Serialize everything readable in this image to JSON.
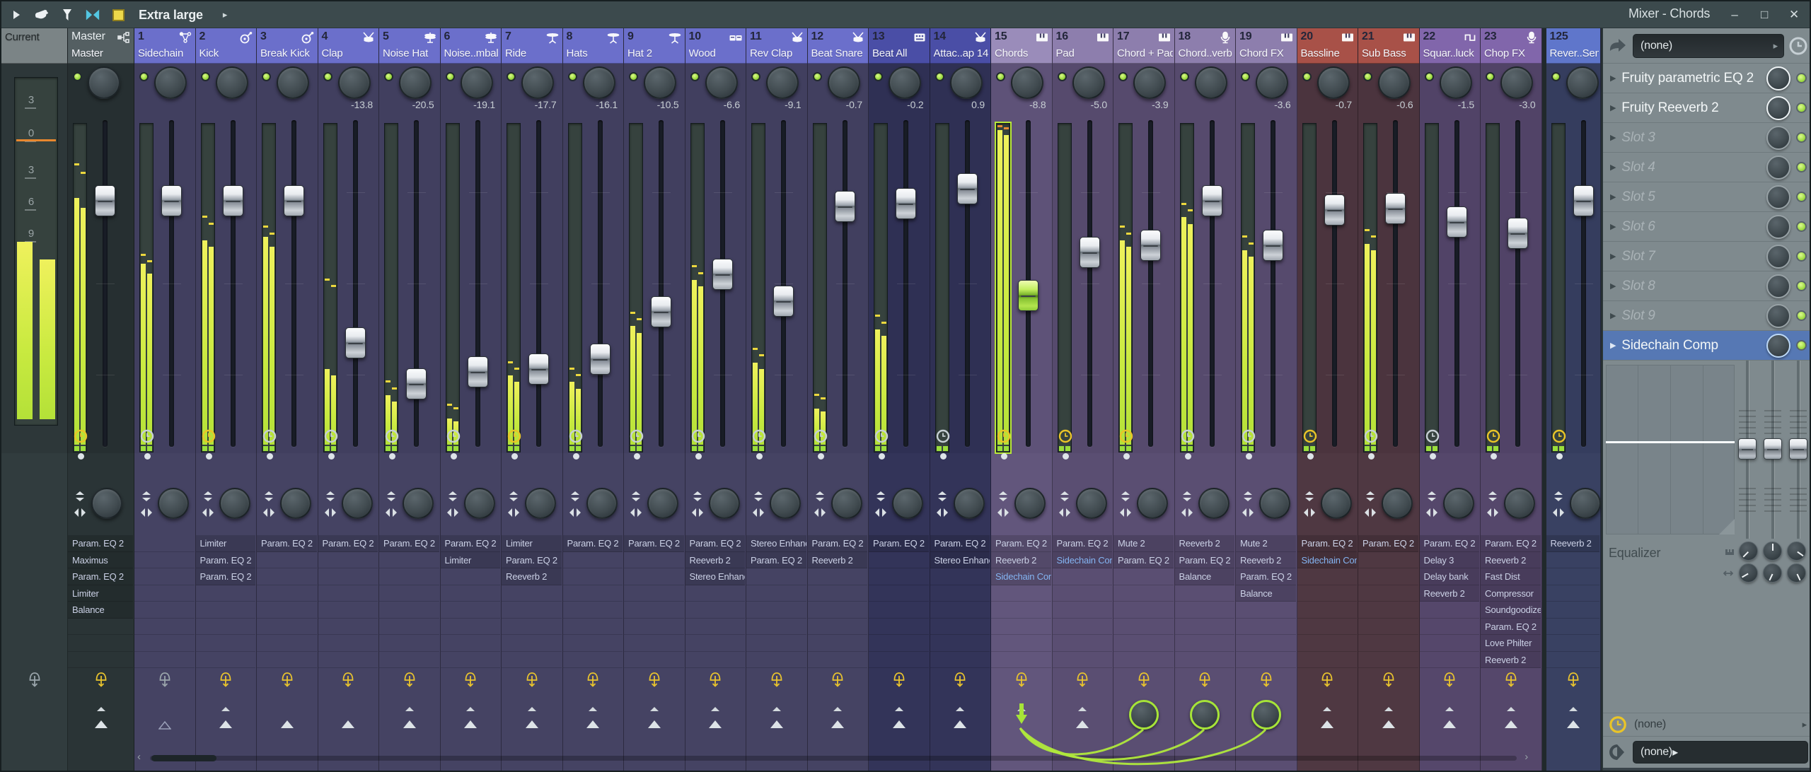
{
  "window": {
    "title": "Mixer - Chords",
    "buttons": {
      "minimize": "–",
      "maximize": "□",
      "close": "✕"
    }
  },
  "toolbar": {
    "view_mode": "Extra large",
    "icons": [
      "menu-arrow",
      "hand",
      "funnel",
      "link-bowtie",
      "color-swatch"
    ],
    "submenu_arrow": "▸"
  },
  "colors": {
    "accent_green": "#aee63c",
    "meter_yellow": "#e9ee54",
    "peak_orange": "#e88a34",
    "lamp_yellow": "#e9c42e",
    "lamp_gray": "#9aa5ab",
    "clock_yellow": "#e9c428",
    "clock_gray": "#c6cfd4",
    "groups": {
      "current": {
        "header": "#7b8486",
        "body": "#2d3739",
        "body2": "#313c3e"
      },
      "master": {
        "header": "#545f62",
        "body": "#262f31",
        "body2": "#2a3436"
      },
      "blue": {
        "header": "#6b6fcb",
        "body": "#413f5f",
        "body2": "#454363"
      },
      "navy": {
        "header": "#4a4ea6",
        "body": "#2f3054",
        "body2": "#333459"
      },
      "violet": {
        "header": "#8d7ead",
        "body": "#564a6d",
        "body2": "#5a4e72"
      },
      "violetsel": {
        "header": "#9a8cba",
        "body": "#5e5278",
        "body2": "#62567c"
      },
      "red": {
        "header": "#a85148",
        "body": "#4b343e",
        "body2": "#4f3842"
      },
      "purple": {
        "header": "#8166ab",
        "body": "#514367",
        "body2": "#55476b"
      },
      "send": {
        "header": "#5f76cb",
        "body": "#353d5e",
        "body2": "#394162"
      }
    }
  },
  "current_strip": {
    "label": "Current",
    "scale_labels": [
      "3",
      "0",
      "3",
      "6",
      "9"
    ],
    "scale_fracs": [
      0.065,
      0.16,
      0.266,
      0.357,
      0.448
    ],
    "peak_frac": 0.177,
    "meter_l": 0.462,
    "meter_r": 0.513,
    "lamp": "gray"
  },
  "strips": [
    {
      "num": "",
      "name": "Master",
      "tab": "Master",
      "icon": "routing",
      "group": "master",
      "db": "",
      "fader": 0.22,
      "meter": {
        "l": 0.22,
        "r": 0.25,
        "pl": 0.12,
        "pr": 0.145
      },
      "clock": "yellow",
      "caret": true,
      "plugins": [
        {
          "n": "Param. EQ 2"
        },
        {
          "n": "Maximus"
        },
        {
          "n": "Param. EQ 2"
        },
        {
          "n": "Limiter"
        },
        {
          "n": "Balance"
        }
      ]
    },
    {
      "num": "1",
      "name": "Sidechain",
      "icon": "sidechain",
      "group": "blue",
      "db": "",
      "fader": 0.22,
      "meter": {
        "l": 0.42,
        "r": 0.45,
        "pl": 0.395,
        "pr": 0.415
      },
      "clock": "gray",
      "bottom": "hollow",
      "plugins": []
    },
    {
      "num": "2",
      "name": "Kick",
      "icon": "kick",
      "group": "blue",
      "db": "",
      "fader": 0.22,
      "meter": {
        "l": 0.35,
        "r": 0.37,
        "pl": 0.28,
        "pr": 0.3
      },
      "clock": "yellow",
      "caret": true,
      "plugins": [
        {
          "n": "Limiter"
        },
        {
          "n": "Param. EQ 2"
        },
        {
          "n": "Param. EQ 2"
        }
      ]
    },
    {
      "num": "3",
      "name": "Break Kick",
      "icon": "kick",
      "group": "blue",
      "db": "",
      "fader": 0.22,
      "meter": {
        "l": 0.34,
        "r": 0.37,
        "pl": 0.31,
        "pr": 0.33
      },
      "clock": "gray",
      "plugins": [
        {
          "n": "Param. EQ 2"
        }
      ]
    },
    {
      "num": "4",
      "name": "Clap",
      "icon": "snare",
      "group": "blue",
      "db": "-13.8",
      "fader": 0.7,
      "meter": {
        "l": 0.74,
        "r": 0.76,
        "pl": 0.47,
        "pr": 0.49
      },
      "clock": "gray",
      "plugins": [
        {
          "n": "Param. EQ 2"
        }
      ]
    },
    {
      "num": "5",
      "name": "Noise Hat",
      "icon": "hihat",
      "group": "blue",
      "db": "-20.5",
      "fader": 0.84,
      "meter": {
        "l": 0.82,
        "r": 0.84,
        "pl": 0.78,
        "pr": 0.8
      },
      "clock": "gray",
      "caret": true,
      "plugins": [
        {
          "n": "Param. EQ 2"
        }
      ]
    },
    {
      "num": "6",
      "name": "Noise..mbal",
      "icon": "hihat",
      "group": "blue",
      "db": "-19.1",
      "fader": 0.8,
      "meter": {
        "l": 0.89,
        "r": 0.9,
        "pl": 0.85,
        "pr": 0.86
      },
      "clock": "gray",
      "caret": true,
      "plugins": [
        {
          "n": "Param. EQ 2"
        },
        {
          "n": "Limiter"
        }
      ]
    },
    {
      "num": "7",
      "name": "Ride",
      "icon": "cymbal",
      "group": "blue",
      "db": "-17.7",
      "fader": 0.79,
      "meter": {
        "l": 0.76,
        "r": 0.78,
        "pl": 0.72,
        "pr": 0.74
      },
      "clock": "yellow",
      "caret": true,
      "plugins": [
        {
          "n": "Limiter"
        },
        {
          "n": "Param. EQ 2"
        },
        {
          "n": "Reeverb 2"
        }
      ]
    },
    {
      "num": "8",
      "name": "Hats",
      "icon": "cymbal",
      "group": "blue",
      "db": "-16.1",
      "fader": 0.755,
      "meter": {
        "l": 0.78,
        "r": 0.8,
        "pl": 0.74,
        "pr": 0.76
      },
      "clock": "gray",
      "caret": true,
      "plugins": [
        {
          "n": "Param. EQ 2"
        }
      ]
    },
    {
      "num": "9",
      "name": "Hat 2",
      "icon": "cymbal",
      "group": "blue",
      "db": "-10.5",
      "fader": 0.595,
      "meter": {
        "l": 0.61,
        "r": 0.63,
        "pl": 0.57,
        "pr": 0.59
      },
      "clock": "gray",
      "caret": true,
      "plugins": [
        {
          "n": "Param. EQ 2"
        }
      ]
    },
    {
      "num": "10",
      "name": "Wood",
      "icon": "bongos",
      "group": "blue",
      "db": "-6.6",
      "fader": 0.47,
      "meter": {
        "l": 0.47,
        "r": 0.49,
        "pl": 0.43,
        "pr": 0.45
      },
      "clock": "gray",
      "caret": true,
      "plugins": [
        {
          "n": "Param. EQ 2"
        },
        {
          "n": "Reeverb 2"
        },
        {
          "n": "Stereo Enhancer"
        }
      ]
    },
    {
      "num": "11",
      "name": "Rev Clap",
      "icon": "snare",
      "group": "blue",
      "db": "-9.1",
      "fader": 0.56,
      "meter": {
        "l": 0.72,
        "r": 0.74,
        "pl": 0.68,
        "pr": 0.7
      },
      "clock": "gray",
      "caret": true,
      "plugins": [
        {
          "n": "Stereo Enhancer"
        },
        {
          "n": "Param. EQ 2"
        }
      ]
    },
    {
      "num": "12",
      "name": "Beat Snare",
      "icon": "snare",
      "group": "blue",
      "db": "-0.7",
      "fader": 0.24,
      "meter": {
        "l": 0.86,
        "r": 0.87,
        "pl": 0.82,
        "pr": 0.83
      },
      "clock": "gray",
      "caret": true,
      "plugins": [
        {
          "n": "Param. EQ 2"
        },
        {
          "n": "Reeverb 2"
        }
      ]
    },
    {
      "num": "13",
      "name": "Beat All",
      "icon": "machine",
      "group": "navy",
      "db": "-0.2",
      "fader": 0.23,
      "meter": {
        "l": 0.62,
        "r": 0.64,
        "pl": 0.58,
        "pr": 0.6
      },
      "clock": "gray",
      "caret": true,
      "plugins": [
        {
          "n": "Param. EQ 2"
        }
      ]
    },
    {
      "num": "14",
      "name": "Attac..ap 14",
      "icon": "snare",
      "group": "navy",
      "db": "0.9",
      "fader": 0.18,
      "meter": null,
      "clock": "gray",
      "caret": true,
      "plugins": [
        {
          "n": "Param. EQ 2"
        },
        {
          "n": "Stereo Enhancer"
        }
      ]
    },
    {
      "num": "15",
      "name": "Chords",
      "icon": "piano",
      "group": "violetsel",
      "selected": true,
      "db": "-8.8",
      "fader": 0.54,
      "meter": {
        "l": 0.015,
        "r": 0.03,
        "pl": 0.005,
        "pr": 0.01,
        "peak_color": "orange"
      },
      "clock": "yellow",
      "bottom": "down-arrow",
      "caret": true,
      "plugins": [
        {
          "n": "Param. EQ 2"
        },
        {
          "n": "Reeverb 2"
        },
        {
          "n": "Sidechain Comp",
          "linked": true
        }
      ]
    },
    {
      "num": "16",
      "name": "Pad",
      "icon": "piano",
      "group": "violet",
      "db": "-5.0",
      "fader": 0.395,
      "meter": null,
      "clock": "yellow",
      "caret": true,
      "plugins": [
        {
          "n": "Param. EQ 2"
        },
        {
          "n": "Sidechain Comp",
          "linked": true
        }
      ]
    },
    {
      "num": "17",
      "name": "Chord + Pad",
      "icon": "piano",
      "group": "violet",
      "db": "-3.9",
      "fader": 0.37,
      "meter": {
        "l": 0.35,
        "r": 0.37,
        "pl": 0.31,
        "pr": 0.33
      },
      "clock": "yellow",
      "bottom": "send-knob",
      "plugins": [
        {
          "n": "Mute 2"
        },
        {
          "n": "Param. EQ 2"
        }
      ]
    },
    {
      "num": "18",
      "name": "Chord..verb",
      "icon": "mic",
      "group": "violet",
      "db": "",
      "fader": 0.22,
      "meter": {
        "l": 0.28,
        "r": 0.3,
        "pl": 0.24,
        "pr": 0.26
      },
      "clock": "gray",
      "bottom": "send-knob",
      "plugins": [
        {
          "n": "Reeverb 2"
        },
        {
          "n": "Param. EQ 2"
        },
        {
          "n": "Balance"
        }
      ]
    },
    {
      "num": "19",
      "name": "Chord FX",
      "icon": "piano",
      "group": "violet",
      "db": "-3.6",
      "fader": 0.37,
      "meter": {
        "l": 0.38,
        "r": 0.4,
        "pl": 0.34,
        "pr": 0.36
      },
      "clock": "gray",
      "bottom": "send-knob",
      "plugins": [
        {
          "n": "Mute 2"
        },
        {
          "n": "Reeverb 2"
        },
        {
          "n": "Param. EQ 2"
        },
        {
          "n": "Balance"
        }
      ]
    },
    {
      "num": "20",
      "name": "Bassline",
      "icon": "piano",
      "group": "red",
      "db": "-0.7",
      "fader": 0.25,
      "meter": null,
      "clock": "yellow",
      "caret": true,
      "plugins": [
        {
          "n": "Param. EQ 2"
        },
        {
          "n": "Sidechain Comp",
          "linked": true
        }
      ]
    },
    {
      "num": "21",
      "name": "Sub Bass",
      "icon": "piano",
      "group": "red",
      "db": "-0.6",
      "fader": 0.246,
      "meter": {
        "l": 0.36,
        "r": 0.38,
        "pl": 0.32,
        "pr": 0.34
      },
      "clock": "gray",
      "caret": true,
      "plugins": [
        {
          "n": "Param. EQ 2"
        }
      ]
    },
    {
      "num": "22",
      "name": "Squar..luck",
      "icon": "square-wave",
      "group": "purple",
      "db": "-1.5",
      "fader": 0.293,
      "meter": null,
      "clock": "gray",
      "caret": true,
      "plugins": [
        {
          "n": "Param. EQ 2"
        },
        {
          "n": "Delay 3"
        },
        {
          "n": "Delay bank"
        },
        {
          "n": "Reeverb 2"
        }
      ]
    },
    {
      "num": "23",
      "name": "Chop FX",
      "icon": "mic",
      "group": "purple",
      "db": "-3.0",
      "fader": 0.33,
      "meter": null,
      "clock": "yellow",
      "caret": true,
      "plugins": [
        {
          "n": "Param. EQ 2"
        },
        {
          "n": "Reeverb 2"
        },
        {
          "n": "Fast Dist"
        },
        {
          "n": "Compressor"
        },
        {
          "n": "Soundgoodizer"
        },
        {
          "n": "Param. EQ 2"
        },
        {
          "n": "Love Philter"
        },
        {
          "n": "Reeverb 2"
        }
      ]
    },
    {
      "num": "125",
      "name": "Rever..Send",
      "icon": "none",
      "group": "send",
      "gap_before": true,
      "db": "",
      "fader": 0.22,
      "meter": null,
      "clock": "yellow",
      "caret": true,
      "plugins": [
        {
          "n": "Reeverb 2"
        }
      ]
    }
  ],
  "panel": {
    "input_value": "(none)",
    "slots": [
      {
        "name": "Fruity parametric EQ 2",
        "state": "active"
      },
      {
        "name": "Fruity Reeverb 2",
        "state": "active"
      },
      {
        "name": "Slot 3",
        "state": "empty"
      },
      {
        "name": "Slot 4",
        "state": "empty"
      },
      {
        "name": "Slot 5",
        "state": "empty"
      },
      {
        "name": "Slot 6",
        "state": "empty"
      },
      {
        "name": "Slot 7",
        "state": "empty"
      },
      {
        "name": "Slot 8",
        "state": "empty"
      },
      {
        "name": "Slot 9",
        "state": "empty"
      },
      {
        "name": "Sidechain Comp",
        "state": "selected"
      }
    ],
    "equalizer_label": "Equalizer",
    "eq_knob_angles": [
      [
        -135,
        0,
        125
      ],
      [
        -120,
        -155,
        155
      ]
    ],
    "time_value": "(none)",
    "output_value": "(none)"
  }
}
